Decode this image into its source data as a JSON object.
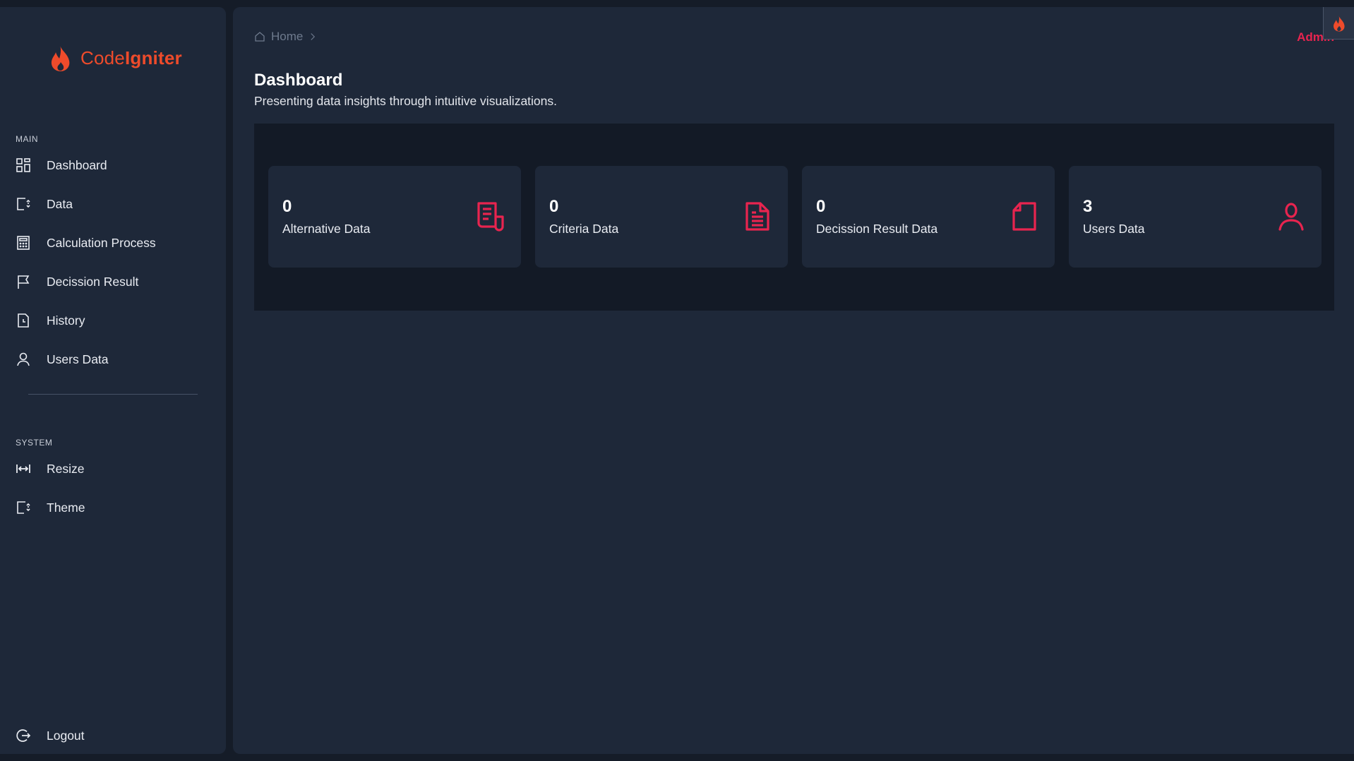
{
  "brand": {
    "name_light": "Code",
    "name_bold": "Igniter",
    "color": "#ee4b2b"
  },
  "sidebar": {
    "main_label": "MAIN",
    "main_items": [
      {
        "label": "Dashboard",
        "icon": "grid-icon"
      },
      {
        "label": "Data",
        "icon": "data-icon"
      },
      {
        "label": "Calculation Process",
        "icon": "calculator-icon"
      },
      {
        "label": "Decission Result",
        "icon": "flag-icon"
      },
      {
        "label": "History",
        "icon": "document-clock-icon"
      },
      {
        "label": "Users Data",
        "icon": "user-icon"
      }
    ],
    "system_label": "SYSTEM",
    "system_items": [
      {
        "label": "Resize",
        "icon": "resize-icon"
      },
      {
        "label": "Theme",
        "icon": "theme-icon"
      }
    ],
    "logout_label": "Logout"
  },
  "header": {
    "breadcrumb_home": "Home",
    "user": "Admin"
  },
  "page": {
    "title": "Dashboard",
    "subtitle": "Presenting data insights through intuitive visualizations."
  },
  "cards": [
    {
      "count": "0",
      "label": "Alternative Data",
      "icon": "report-icon"
    },
    {
      "count": "0",
      "label": "Criteria Data",
      "icon": "file-text-icon"
    },
    {
      "count": "0",
      "label": "Decission Result Data",
      "icon": "file-icon"
    },
    {
      "count": "3",
      "label": "Users Data",
      "icon": "user-icon"
    }
  ],
  "colors": {
    "accent": "#e8244f",
    "background": "#151c28",
    "panel": "#1e2839",
    "stats_panel": "#131a26"
  }
}
